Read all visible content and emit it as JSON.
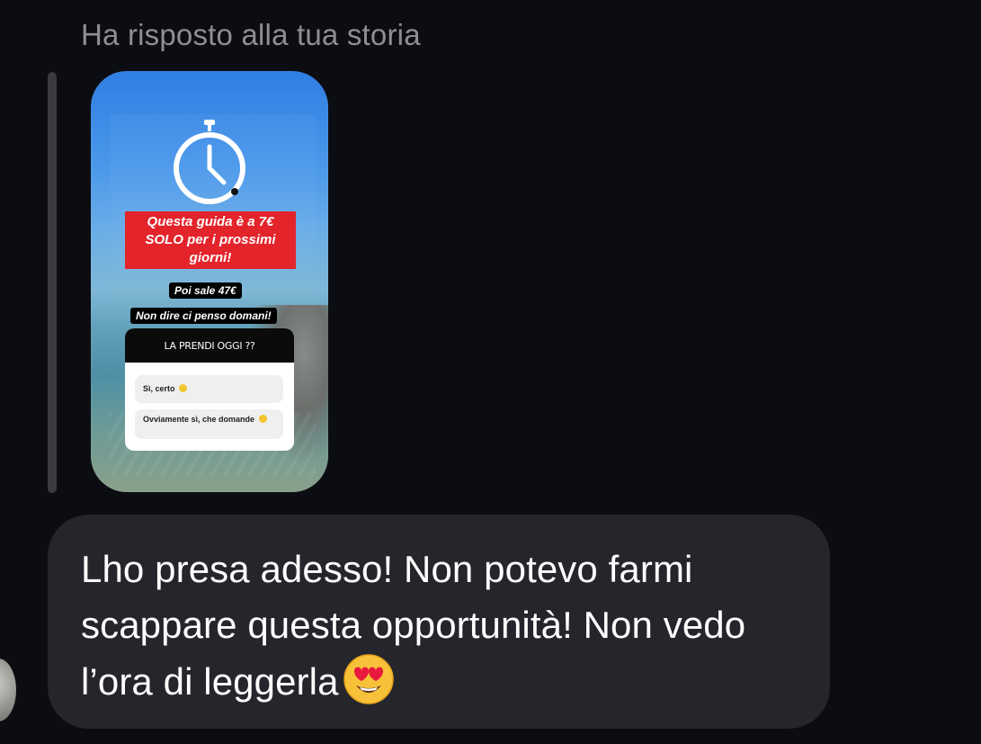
{
  "reply_caption": "Ha risposto alla tua storia",
  "story": {
    "red_sticker_text": "Questa guida è a 7€\nSOLO per i prossimi\ngiorni!",
    "black_sticker_1": "Poi sale 47€",
    "black_sticker_2": "Non dire ci penso domani!",
    "poll": {
      "question": "LA PRENDI OGGI ??",
      "options": [
        "Sì, certo",
        "Ovviamente sì, che domande"
      ]
    },
    "icons": [
      "stopwatch-icon"
    ]
  },
  "message": {
    "text": "Lho presa adesso! Non potevo farmi scappare questa opportunità! Non vedo l’ora di leggerla",
    "trailing_emoji": "heart-eyes-emoji"
  },
  "colors": {
    "background": "#0c0d12",
    "bubble": "#25262b",
    "caption": "#8e8f94",
    "sticker_red": "#e3242b"
  }
}
